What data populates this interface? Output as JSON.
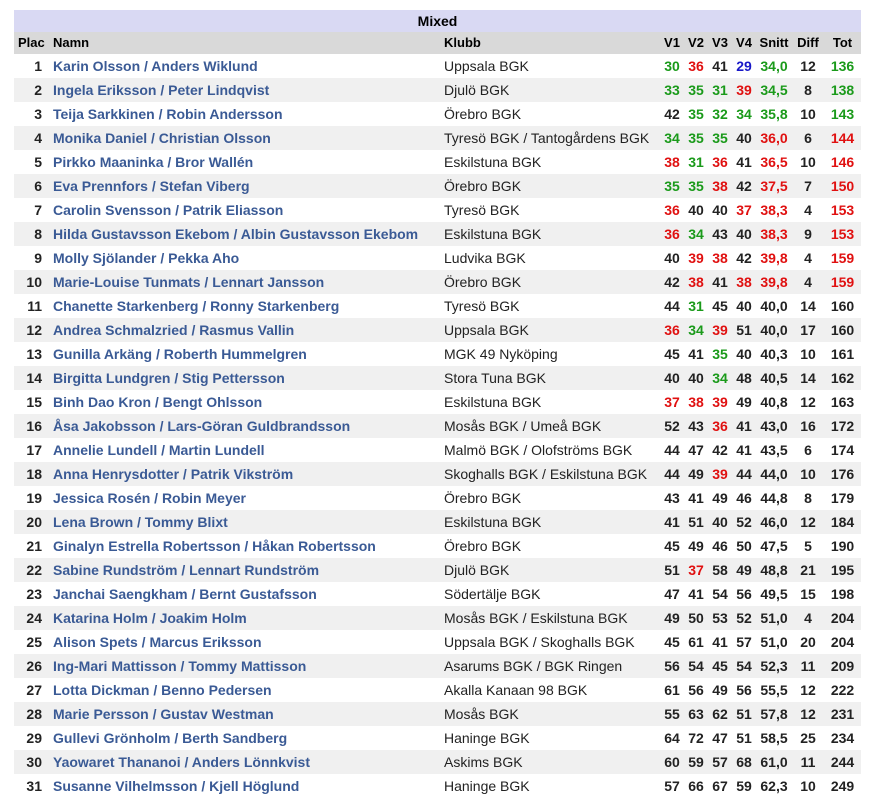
{
  "title": "Mixed",
  "headers": {
    "plac": "Plac",
    "namn": "Namn",
    "klubb": "Klubb",
    "v1": "V1",
    "v2": "V2",
    "v3": "V3",
    "v4": "V4",
    "snitt": "Snitt",
    "diff": "Diff",
    "tot": "Tot"
  },
  "colors": {
    "green": "#1a9a1a",
    "red": "#e01010",
    "blue": "#1818c8",
    "link": "#3a5a95",
    "title_bg": "#d9d9f3",
    "header_bg": "#d9d9d9",
    "stripe": "#f0f0f0"
  },
  "rows": [
    {
      "plac": "1",
      "namn": "Karin Olsson / Anders Wiklund",
      "klubb": "Uppsala BGK",
      "v": [
        "30",
        "36",
        "41",
        "29"
      ],
      "vc": [
        "g",
        "r",
        "",
        "b"
      ],
      "snitt": "34,0",
      "sc": "g",
      "diff": "12",
      "tot": "136",
      "tc": "g"
    },
    {
      "plac": "2",
      "namn": "Ingela Eriksson / Peter Lindqvist",
      "klubb": "Djulö BGK",
      "v": [
        "33",
        "35",
        "31",
        "39"
      ],
      "vc": [
        "g",
        "g",
        "g",
        "r"
      ],
      "snitt": "34,5",
      "sc": "g",
      "diff": "8",
      "tot": "138",
      "tc": "g"
    },
    {
      "plac": "3",
      "namn": "Teija Sarkkinen / Robin Andersson",
      "klubb": "Örebro BGK",
      "v": [
        "42",
        "35",
        "32",
        "34"
      ],
      "vc": [
        "",
        "g",
        "g",
        "g"
      ],
      "snitt": "35,8",
      "sc": "g",
      "diff": "10",
      "tot": "143",
      "tc": "g"
    },
    {
      "plac": "4",
      "namn": "Monika Daniel / Christian Olsson",
      "klubb": "Tyresö BGK / Tantogårdens BGK",
      "v": [
        "34",
        "35",
        "35",
        "40"
      ],
      "vc": [
        "g",
        "g",
        "g",
        ""
      ],
      "snitt": "36,0",
      "sc": "r",
      "diff": "6",
      "tot": "144",
      "tc": "r"
    },
    {
      "plac": "5",
      "namn": "Pirkko Maaninka / Bror Wallén",
      "klubb": "Eskilstuna BGK",
      "v": [
        "38",
        "31",
        "36",
        "41"
      ],
      "vc": [
        "r",
        "g",
        "r",
        ""
      ],
      "snitt": "36,5",
      "sc": "r",
      "diff": "10",
      "tot": "146",
      "tc": "r"
    },
    {
      "plac": "6",
      "namn": "Eva Prennfors / Stefan Viberg",
      "klubb": "Örebro BGK",
      "v": [
        "35",
        "35",
        "38",
        "42"
      ],
      "vc": [
        "g",
        "g",
        "r",
        ""
      ],
      "snitt": "37,5",
      "sc": "r",
      "diff": "7",
      "tot": "150",
      "tc": "r"
    },
    {
      "plac": "7",
      "namn": "Carolin Svensson / Patrik Eliasson",
      "klubb": "Tyresö BGK",
      "v": [
        "36",
        "40",
        "40",
        "37"
      ],
      "vc": [
        "r",
        "",
        "",
        "r"
      ],
      "snitt": "38,3",
      "sc": "r",
      "diff": "4",
      "tot": "153",
      "tc": "r"
    },
    {
      "plac": "8",
      "namn": "Hilda Gustavsson Ekebom / Albin Gustavsson Ekebom",
      "klubb": "Eskilstuna BGK",
      "v": [
        "36",
        "34",
        "43",
        "40"
      ],
      "vc": [
        "r",
        "g",
        "",
        ""
      ],
      "snitt": "38,3",
      "sc": "r",
      "diff": "9",
      "tot": "153",
      "tc": "r"
    },
    {
      "plac": "9",
      "namn": "Molly Sjölander / Pekka Aho",
      "klubb": "Ludvika BGK",
      "v": [
        "40",
        "39",
        "38",
        "42"
      ],
      "vc": [
        "",
        "r",
        "r",
        ""
      ],
      "snitt": "39,8",
      "sc": "r",
      "diff": "4",
      "tot": "159",
      "tc": "r"
    },
    {
      "plac": "10",
      "namn": "Marie-Louise Tunmats / Lennart Jansson",
      "klubb": "Örebro BGK",
      "v": [
        "42",
        "38",
        "41",
        "38"
      ],
      "vc": [
        "",
        "r",
        "",
        "r"
      ],
      "snitt": "39,8",
      "sc": "r",
      "diff": "4",
      "tot": "159",
      "tc": "r"
    },
    {
      "plac": "11",
      "namn": "Chanette Starkenberg / Ronny Starkenberg",
      "klubb": "Tyresö BGK",
      "v": [
        "44",
        "31",
        "45",
        "40"
      ],
      "vc": [
        "",
        "g",
        "",
        ""
      ],
      "snitt": "40,0",
      "sc": "",
      "diff": "14",
      "tot": "160",
      "tc": ""
    },
    {
      "plac": "12",
      "namn": "Andrea Schmalzried / Rasmus Vallin",
      "klubb": "Uppsala BGK",
      "v": [
        "36",
        "34",
        "39",
        "51"
      ],
      "vc": [
        "r",
        "g",
        "r",
        ""
      ],
      "snitt": "40,0",
      "sc": "",
      "diff": "17",
      "tot": "160",
      "tc": ""
    },
    {
      "plac": "13",
      "namn": "Gunilla Arkäng / Roberth Hummelgren",
      "klubb": "MGK 49 Nyköping",
      "v": [
        "45",
        "41",
        "35",
        "40"
      ],
      "vc": [
        "",
        "",
        "g",
        ""
      ],
      "snitt": "40,3",
      "sc": "",
      "diff": "10",
      "tot": "161",
      "tc": ""
    },
    {
      "plac": "14",
      "namn": "Birgitta Lundgren / Stig Pettersson",
      "klubb": "Stora Tuna BGK",
      "v": [
        "40",
        "40",
        "34",
        "48"
      ],
      "vc": [
        "",
        "",
        "g",
        ""
      ],
      "snitt": "40,5",
      "sc": "",
      "diff": "14",
      "tot": "162",
      "tc": ""
    },
    {
      "plac": "15",
      "namn": "Binh Dao Kron / Bengt Ohlsson",
      "klubb": "Eskilstuna BGK",
      "v": [
        "37",
        "38",
        "39",
        "49"
      ],
      "vc": [
        "r",
        "r",
        "r",
        ""
      ],
      "snitt": "40,8",
      "sc": "",
      "diff": "12",
      "tot": "163",
      "tc": ""
    },
    {
      "plac": "16",
      "namn": "Åsa Jakobsson / Lars-Göran Guldbrandsson",
      "klubb": "Mosås BGK / Umeå BGK",
      "v": [
        "52",
        "43",
        "36",
        "41"
      ],
      "vc": [
        "",
        "",
        "r",
        ""
      ],
      "snitt": "43,0",
      "sc": "",
      "diff": "16",
      "tot": "172",
      "tc": ""
    },
    {
      "plac": "17",
      "namn": "Annelie Lundell / Martin Lundell",
      "klubb": "Malmö BGK / Olofströms BGK",
      "v": [
        "44",
        "47",
        "42",
        "41"
      ],
      "vc": [
        "",
        "",
        "",
        ""
      ],
      "snitt": "43,5",
      "sc": "",
      "diff": "6",
      "tot": "174",
      "tc": ""
    },
    {
      "plac": "18",
      "namn": "Anna Henrysdotter / Patrik Vikström",
      "klubb": "Skoghalls BGK / Eskilstuna BGK",
      "v": [
        "44",
        "49",
        "39",
        "44"
      ],
      "vc": [
        "",
        "",
        "r",
        ""
      ],
      "snitt": "44,0",
      "sc": "",
      "diff": "10",
      "tot": "176",
      "tc": ""
    },
    {
      "plac": "19",
      "namn": "Jessica Rosén / Robin Meyer",
      "klubb": "Örebro BGK",
      "v": [
        "43",
        "41",
        "49",
        "46"
      ],
      "vc": [
        "",
        "",
        "",
        ""
      ],
      "snitt": "44,8",
      "sc": "",
      "diff": "8",
      "tot": "179",
      "tc": ""
    },
    {
      "plac": "20",
      "namn": "Lena Brown / Tommy Blixt",
      "klubb": "Eskilstuna BGK",
      "v": [
        "41",
        "51",
        "40",
        "52"
      ],
      "vc": [
        "",
        "",
        "",
        ""
      ],
      "snitt": "46,0",
      "sc": "",
      "diff": "12",
      "tot": "184",
      "tc": ""
    },
    {
      "plac": "21",
      "namn": "Ginalyn Estrella Robertsson / Håkan Robertsson",
      "klubb": "Örebro BGK",
      "v": [
        "45",
        "49",
        "46",
        "50"
      ],
      "vc": [
        "",
        "",
        "",
        ""
      ],
      "snitt": "47,5",
      "sc": "",
      "diff": "5",
      "tot": "190",
      "tc": ""
    },
    {
      "plac": "22",
      "namn": "Sabine Rundström / Lennart Rundström",
      "klubb": "Djulö BGK",
      "v": [
        "51",
        "37",
        "58",
        "49"
      ],
      "vc": [
        "",
        "r",
        "",
        ""
      ],
      "snitt": "48,8",
      "sc": "",
      "diff": "21",
      "tot": "195",
      "tc": ""
    },
    {
      "plac": "23",
      "namn": "Janchai Saengkham / Bernt Gustafsson",
      "klubb": "Södertälje BGK",
      "v": [
        "47",
        "41",
        "54",
        "56"
      ],
      "vc": [
        "",
        "",
        "",
        ""
      ],
      "snitt": "49,5",
      "sc": "",
      "diff": "15",
      "tot": "198",
      "tc": ""
    },
    {
      "plac": "24",
      "namn": "Katarina Holm / Joakim Holm",
      "klubb": "Mosås BGK / Eskilstuna BGK",
      "v": [
        "49",
        "50",
        "53",
        "52"
      ],
      "vc": [
        "",
        "",
        "",
        ""
      ],
      "snitt": "51,0",
      "sc": "",
      "diff": "4",
      "tot": "204",
      "tc": ""
    },
    {
      "plac": "25",
      "namn": "Alison Spets / Marcus Eriksson",
      "klubb": "Uppsala BGK / Skoghalls BGK",
      "v": [
        "45",
        "61",
        "41",
        "57"
      ],
      "vc": [
        "",
        "",
        "",
        ""
      ],
      "snitt": "51,0",
      "sc": "",
      "diff": "20",
      "tot": "204",
      "tc": ""
    },
    {
      "plac": "26",
      "namn": "Ing-Mari Mattisson / Tommy Mattisson",
      "klubb": "Asarums BGK / BGK Ringen",
      "v": [
        "56",
        "54",
        "45",
        "54"
      ],
      "vc": [
        "",
        "",
        "",
        ""
      ],
      "snitt": "52,3",
      "sc": "",
      "diff": "11",
      "tot": "209",
      "tc": ""
    },
    {
      "plac": "27",
      "namn": "Lotta Dickman / Benno Pedersen",
      "klubb": "Akalla Kanaan 98 BGK",
      "v": [
        "61",
        "56",
        "49",
        "56"
      ],
      "vc": [
        "",
        "",
        "",
        ""
      ],
      "snitt": "55,5",
      "sc": "",
      "diff": "12",
      "tot": "222",
      "tc": ""
    },
    {
      "plac": "28",
      "namn": "Marie Persson / Gustav Westman",
      "klubb": "Mosås BGK",
      "v": [
        "55",
        "63",
        "62",
        "51"
      ],
      "vc": [
        "",
        "",
        "",
        ""
      ],
      "snitt": "57,8",
      "sc": "",
      "diff": "12",
      "tot": "231",
      "tc": ""
    },
    {
      "plac": "29",
      "namn": "Gullevi Grönholm / Berth Sandberg",
      "klubb": "Haninge BGK",
      "v": [
        "64",
        "72",
        "47",
        "51"
      ],
      "vc": [
        "",
        "",
        "",
        ""
      ],
      "snitt": "58,5",
      "sc": "",
      "diff": "25",
      "tot": "234",
      "tc": ""
    },
    {
      "plac": "30",
      "namn": "Yaowaret Thananoi / Anders Lönnkvist",
      "klubb": "Askims BGK",
      "v": [
        "60",
        "59",
        "57",
        "68"
      ],
      "vc": [
        "",
        "",
        "",
        ""
      ],
      "snitt": "61,0",
      "sc": "",
      "diff": "11",
      "tot": "244",
      "tc": ""
    },
    {
      "plac": "31",
      "namn": "Susanne Vilhelmsson / Kjell Höglund",
      "klubb": "Haninge BGK",
      "v": [
        "57",
        "66",
        "67",
        "59"
      ],
      "vc": [
        "",
        "",
        "",
        ""
      ],
      "snitt": "62,3",
      "sc": "",
      "diff": "10",
      "tot": "249",
      "tc": ""
    }
  ]
}
